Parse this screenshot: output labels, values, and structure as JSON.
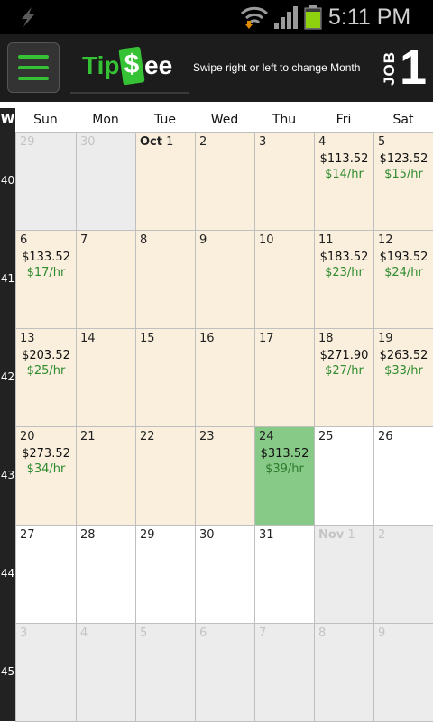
{
  "status_bar": {
    "time": "5:11 PM",
    "icons": [
      "flash-icon",
      "wifi-icon",
      "signal-icon",
      "battery-icon"
    ],
    "battery_color": "#8ed20f"
  },
  "action_bar": {
    "menu_icon": "hamburger-menu-icon",
    "logo": {
      "part1": "Tip",
      "dollar": "$",
      "part2": "ee"
    },
    "hint": "Swipe right or left to change Month",
    "job_label": "JOB",
    "job_number": "1"
  },
  "colors": {
    "current_month_cell": "#faefdc",
    "other_month_cell": "#ececec",
    "today_cell": "#87c987",
    "rate_text": "#2e8b2e",
    "brand_green": "#35c234"
  },
  "calendar": {
    "week_header": "W",
    "day_headers": [
      "Sun",
      "Mon",
      "Tue",
      "Wed",
      "Thu",
      "Fri",
      "Sat"
    ],
    "weeks": [
      {
        "number": "40",
        "days": [
          {
            "day": "29",
            "month_label": "",
            "state": "other",
            "amount": "",
            "rate": ""
          },
          {
            "day": "30",
            "month_label": "",
            "state": "other",
            "amount": "",
            "rate": ""
          },
          {
            "day": "1",
            "month_label": "Oct",
            "state": "current",
            "amount": "",
            "rate": ""
          },
          {
            "day": "2",
            "month_label": "",
            "state": "current",
            "amount": "",
            "rate": ""
          },
          {
            "day": "3",
            "month_label": "",
            "state": "current",
            "amount": "",
            "rate": ""
          },
          {
            "day": "4",
            "month_label": "",
            "state": "current",
            "amount": "$113.52",
            "rate": "$14/hr"
          },
          {
            "day": "5",
            "month_label": "",
            "state": "current",
            "amount": "$123.52",
            "rate": "$15/hr"
          }
        ]
      },
      {
        "number": "41",
        "days": [
          {
            "day": "6",
            "month_label": "",
            "state": "current",
            "amount": "$133.52",
            "rate": "$17/hr"
          },
          {
            "day": "7",
            "month_label": "",
            "state": "current",
            "amount": "",
            "rate": ""
          },
          {
            "day": "8",
            "month_label": "",
            "state": "current",
            "amount": "",
            "rate": ""
          },
          {
            "day": "9",
            "month_label": "",
            "state": "current",
            "amount": "",
            "rate": ""
          },
          {
            "day": "10",
            "month_label": "",
            "state": "current",
            "amount": "",
            "rate": ""
          },
          {
            "day": "11",
            "month_label": "",
            "state": "current",
            "amount": "$183.52",
            "rate": "$23/hr"
          },
          {
            "day": "12",
            "month_label": "",
            "state": "current",
            "amount": "$193.52",
            "rate": "$24/hr"
          }
        ]
      },
      {
        "number": "42",
        "days": [
          {
            "day": "13",
            "month_label": "",
            "state": "current",
            "amount": "$203.52",
            "rate": "$25/hr"
          },
          {
            "day": "14",
            "month_label": "",
            "state": "current",
            "amount": "",
            "rate": ""
          },
          {
            "day": "15",
            "month_label": "",
            "state": "current",
            "amount": "",
            "rate": ""
          },
          {
            "day": "16",
            "month_label": "",
            "state": "current",
            "amount": "",
            "rate": ""
          },
          {
            "day": "17",
            "month_label": "",
            "state": "current",
            "amount": "",
            "rate": ""
          },
          {
            "day": "18",
            "month_label": "",
            "state": "current",
            "amount": "$271.90",
            "rate": "$27/hr"
          },
          {
            "day": "19",
            "month_label": "",
            "state": "current",
            "amount": "$263.52",
            "rate": "$33/hr"
          }
        ]
      },
      {
        "number": "43",
        "days": [
          {
            "day": "20",
            "month_label": "",
            "state": "current",
            "amount": "$273.52",
            "rate": "$34/hr"
          },
          {
            "day": "21",
            "month_label": "",
            "state": "current",
            "amount": "",
            "rate": ""
          },
          {
            "day": "22",
            "month_label": "",
            "state": "current",
            "amount": "",
            "rate": ""
          },
          {
            "day": "23",
            "month_label": "",
            "state": "current",
            "amount": "",
            "rate": ""
          },
          {
            "day": "24",
            "month_label": "",
            "state": "today",
            "amount": "$313.52",
            "rate": "$39/hr"
          },
          {
            "day": "25",
            "month_label": "",
            "state": "future",
            "amount": "",
            "rate": ""
          },
          {
            "day": "26",
            "month_label": "",
            "state": "future",
            "amount": "",
            "rate": ""
          }
        ]
      },
      {
        "number": "44",
        "days": [
          {
            "day": "27",
            "month_label": "",
            "state": "future",
            "amount": "",
            "rate": ""
          },
          {
            "day": "28",
            "month_label": "",
            "state": "future",
            "amount": "",
            "rate": ""
          },
          {
            "day": "29",
            "month_label": "",
            "state": "future",
            "amount": "",
            "rate": ""
          },
          {
            "day": "30",
            "month_label": "",
            "state": "future",
            "amount": "",
            "rate": ""
          },
          {
            "day": "31",
            "month_label": "",
            "state": "future",
            "amount": "",
            "rate": ""
          },
          {
            "day": "1",
            "month_label": "Nov",
            "state": "other",
            "amount": "",
            "rate": ""
          },
          {
            "day": "2",
            "month_label": "",
            "state": "other",
            "amount": "",
            "rate": ""
          }
        ]
      },
      {
        "number": "45",
        "days": [
          {
            "day": "3",
            "month_label": "",
            "state": "other",
            "amount": "",
            "rate": ""
          },
          {
            "day": "4",
            "month_label": "",
            "state": "other",
            "amount": "",
            "rate": ""
          },
          {
            "day": "5",
            "month_label": "",
            "state": "other",
            "amount": "",
            "rate": ""
          },
          {
            "day": "6",
            "month_label": "",
            "state": "other",
            "amount": "",
            "rate": ""
          },
          {
            "day": "7",
            "month_label": "",
            "state": "other",
            "amount": "",
            "rate": ""
          },
          {
            "day": "8",
            "month_label": "",
            "state": "other",
            "amount": "",
            "rate": ""
          },
          {
            "day": "9",
            "month_label": "",
            "state": "other",
            "amount": "",
            "rate": ""
          }
        ]
      }
    ]
  }
}
